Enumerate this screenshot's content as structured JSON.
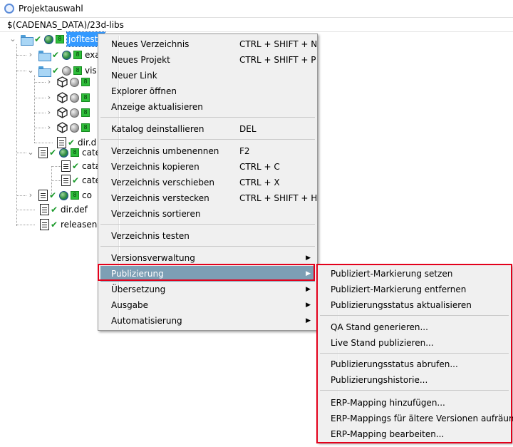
{
  "window": {
    "title": "Projektauswahl"
  },
  "pathbar": {
    "path": "$(CADENAS_DATA)/23d-libs"
  },
  "tree": {
    "root": "jofltest2",
    "nodes": {
      "n1": "exa",
      "n2": "vis",
      "n7": "dir.d",
      "n8": "cate",
      "n9": "cata",
      "n10": "cate",
      "n11": "co",
      "n12": "dir.def",
      "n13": "releasenc"
    },
    "badge": "8"
  },
  "context_menu": {
    "items": [
      {
        "label": "Neues Verzeichnis",
        "shortcut": "CTRL + SHIFT + N"
      },
      {
        "label": "Neues Projekt",
        "shortcut": "CTRL + SHIFT + P"
      },
      {
        "label": "Neuer Link",
        "shortcut": ""
      },
      {
        "label": "Explorer öffnen",
        "shortcut": ""
      },
      {
        "label": "Anzeige aktualisieren",
        "shortcut": ""
      },
      {
        "label": "Katalog deinstallieren",
        "shortcut": "DEL"
      },
      {
        "label": "Verzeichnis umbenennen",
        "shortcut": "F2"
      },
      {
        "label": "Verzeichnis kopieren",
        "shortcut": "CTRL + C"
      },
      {
        "label": "Verzeichnis verschieben",
        "shortcut": "CTRL + X"
      },
      {
        "label": "Verzeichnis verstecken",
        "shortcut": "CTRL + SHIFT + H"
      },
      {
        "label": "Verzeichnis sortieren",
        "shortcut": ""
      },
      {
        "label": "Verzeichnis testen",
        "shortcut": ""
      },
      {
        "label": "Versionsverwaltung",
        "shortcut": ""
      },
      {
        "label": "Publizierung",
        "shortcut": ""
      },
      {
        "label": "Übersetzung",
        "shortcut": ""
      },
      {
        "label": "Ausgabe",
        "shortcut": ""
      },
      {
        "label": "Automatisierung",
        "shortcut": ""
      }
    ],
    "highlighted": "Publizierung"
  },
  "submenu": {
    "items": [
      {
        "label": "Publiziert-Markierung setzen"
      },
      {
        "label": "Publiziert-Markierung entfernen"
      },
      {
        "label": "Publizierungsstatus aktualisieren"
      },
      {
        "label": "QA Stand generieren..."
      },
      {
        "label": "Live Stand publizieren..."
      },
      {
        "label": "Publizierungsstatus abrufen..."
      },
      {
        "label": "Publizierungshistorie..."
      },
      {
        "label": "ERP-Mapping hinzufügen..."
      },
      {
        "label": "ERP-Mappings für ältere Versionen aufräumen..."
      },
      {
        "label": "ERP-Mapping bearbeiten..."
      }
    ]
  },
  "icons": {
    "app": "app-icon",
    "arrow": "▶",
    "expand_open": "⌄",
    "expand_closed": "›",
    "check": "✔"
  },
  "colors": {
    "selection": "#3399ff",
    "menu_highlight": "#7d9fb5",
    "annotation": "#e3001b",
    "menu_bg": "#f0f0f0"
  }
}
